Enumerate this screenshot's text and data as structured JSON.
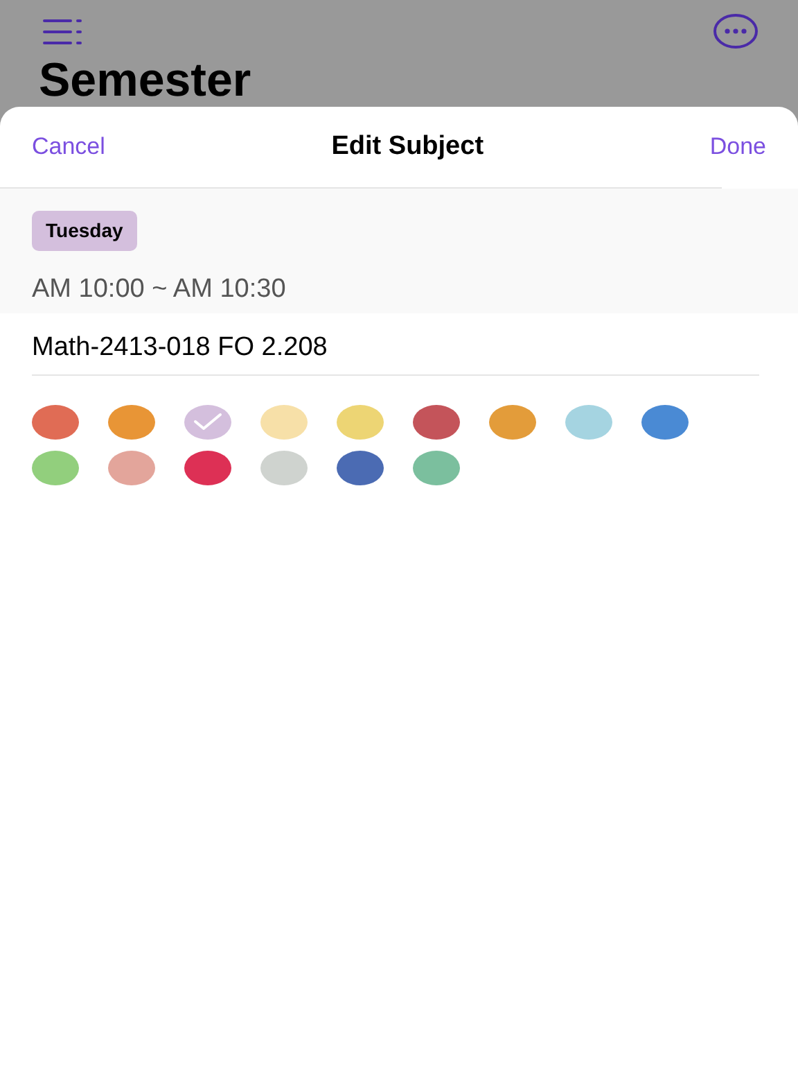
{
  "background": {
    "title": "Semester"
  },
  "sheet": {
    "cancel": "Cancel",
    "title": "Edit Subject",
    "done": "Done"
  },
  "day": "Tuesday",
  "time": "AM 10:00 ~ AM 10:30",
  "subject": {
    "value": "Math-2413-018 FO 2.208"
  },
  "swatches": [
    {
      "color": "#e06c55",
      "selected": false
    },
    {
      "color": "#e89536",
      "selected": false
    },
    {
      "color": "#d4bfdd",
      "selected": true
    },
    {
      "color": "#f7e0a8",
      "selected": false
    },
    {
      "color": "#edd574",
      "selected": false
    },
    {
      "color": "#c4545a",
      "selected": false
    },
    {
      "color": "#e39c3a",
      "selected": false
    },
    {
      "color": "#a5d4e1",
      "selected": false
    },
    {
      "color": "#4a8ad4",
      "selected": false
    },
    {
      "color": "#92cf7d",
      "selected": false
    },
    {
      "color": "#e3a59b",
      "selected": false
    },
    {
      "color": "#dd3055",
      "selected": false
    },
    {
      "color": "#cfd3cf",
      "selected": false
    },
    {
      "color": "#4b6bb3",
      "selected": false
    },
    {
      "color": "#7bbf9e",
      "selected": false
    }
  ]
}
